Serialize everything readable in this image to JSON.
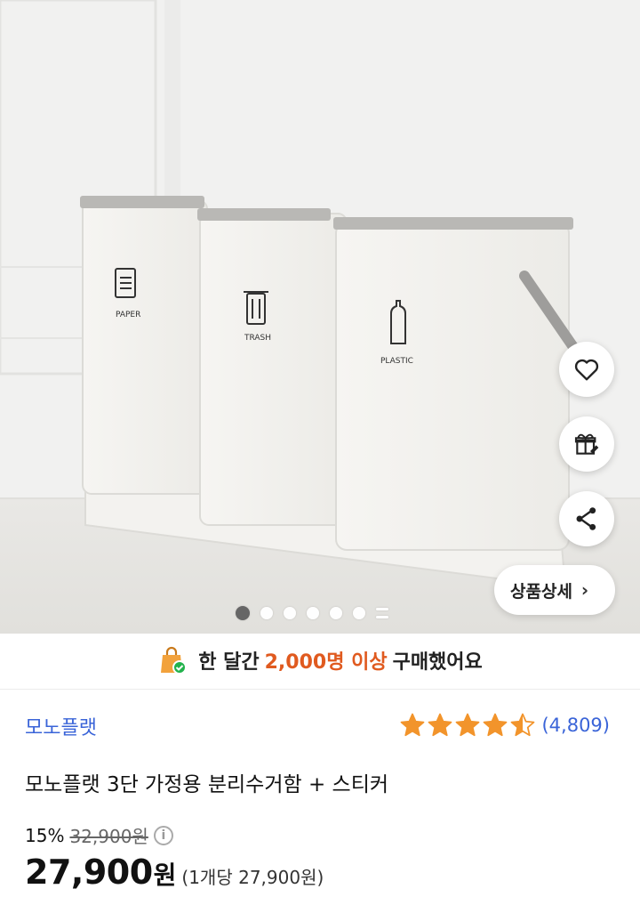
{
  "hero": {
    "bin_labels": [
      "PAPER",
      "TRASH",
      "PLASTIC"
    ],
    "slide_count": 6,
    "active_slide": 1,
    "detail_button_label": "상품상세",
    "actions": [
      "heart-icon",
      "gift-icon",
      "share-icon"
    ]
  },
  "promo": {
    "prefix": "한 달간",
    "highlight": "2,000명 이상",
    "suffix": "구매했어요",
    "highlight_color": "#e05a1f"
  },
  "product": {
    "brand": "모노플랫",
    "rating": 4.5,
    "review_count": "(4,809)",
    "title": "모노플랫 3단 가정용 분리수거함 + 스티커",
    "discount": "15%",
    "original_price": "32,900원",
    "price": "27,900",
    "currency": "원",
    "unit_price": "(1개당 27,900원)"
  },
  "colors": {
    "brand": "#3a64d8",
    "star": "#f2942b"
  }
}
